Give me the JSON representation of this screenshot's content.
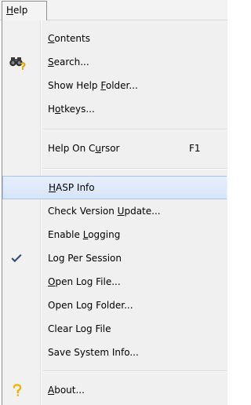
{
  "menubar": {
    "help": {
      "pre": "",
      "key": "H",
      "post": "elp"
    }
  },
  "menu": {
    "items": [
      {
        "pre": "",
        "key": "C",
        "post": "ontents"
      },
      {
        "pre": "",
        "key": "S",
        "post": "earch...",
        "icon": "binoculars-icon"
      },
      {
        "pre": "Show Help ",
        "key": "F",
        "post": "older..."
      },
      {
        "pre": "H",
        "key": "o",
        "post": "tkeys..."
      },
      {
        "pre": "Help On C",
        "key": "u",
        "post": "rsor",
        "shortcut": "F1"
      },
      {
        "pre": "",
        "key": "H",
        "post": "ASP Info",
        "state": "highlighted"
      },
      {
        "pre": "Check Version ",
        "key": "U",
        "post": "pdate..."
      },
      {
        "pre": "Enable ",
        "key": "L",
        "post": "ogging"
      },
      {
        "pre": "Log Per Session",
        "key": "",
        "post": "",
        "checked": true,
        "icon": "checkmark-icon"
      },
      {
        "pre": "",
        "key": "O",
        "post": "pen Log File..."
      },
      {
        "pre": "Open Log Folder...",
        "key": "",
        "post": ""
      },
      {
        "pre": "Clear Log File",
        "key": "",
        "post": ""
      },
      {
        "pre": "Save System Info...",
        "key": "",
        "post": ""
      },
      {
        "pre": "",
        "key": "A",
        "post": "bout...",
        "icon": "question-mark-icon"
      }
    ]
  },
  "colors": {
    "highlight_fill": "#dde8fb",
    "highlight_border": "#a9c4ee",
    "question_mark": "#f2b200",
    "checkmark": "#2f4f7f"
  }
}
